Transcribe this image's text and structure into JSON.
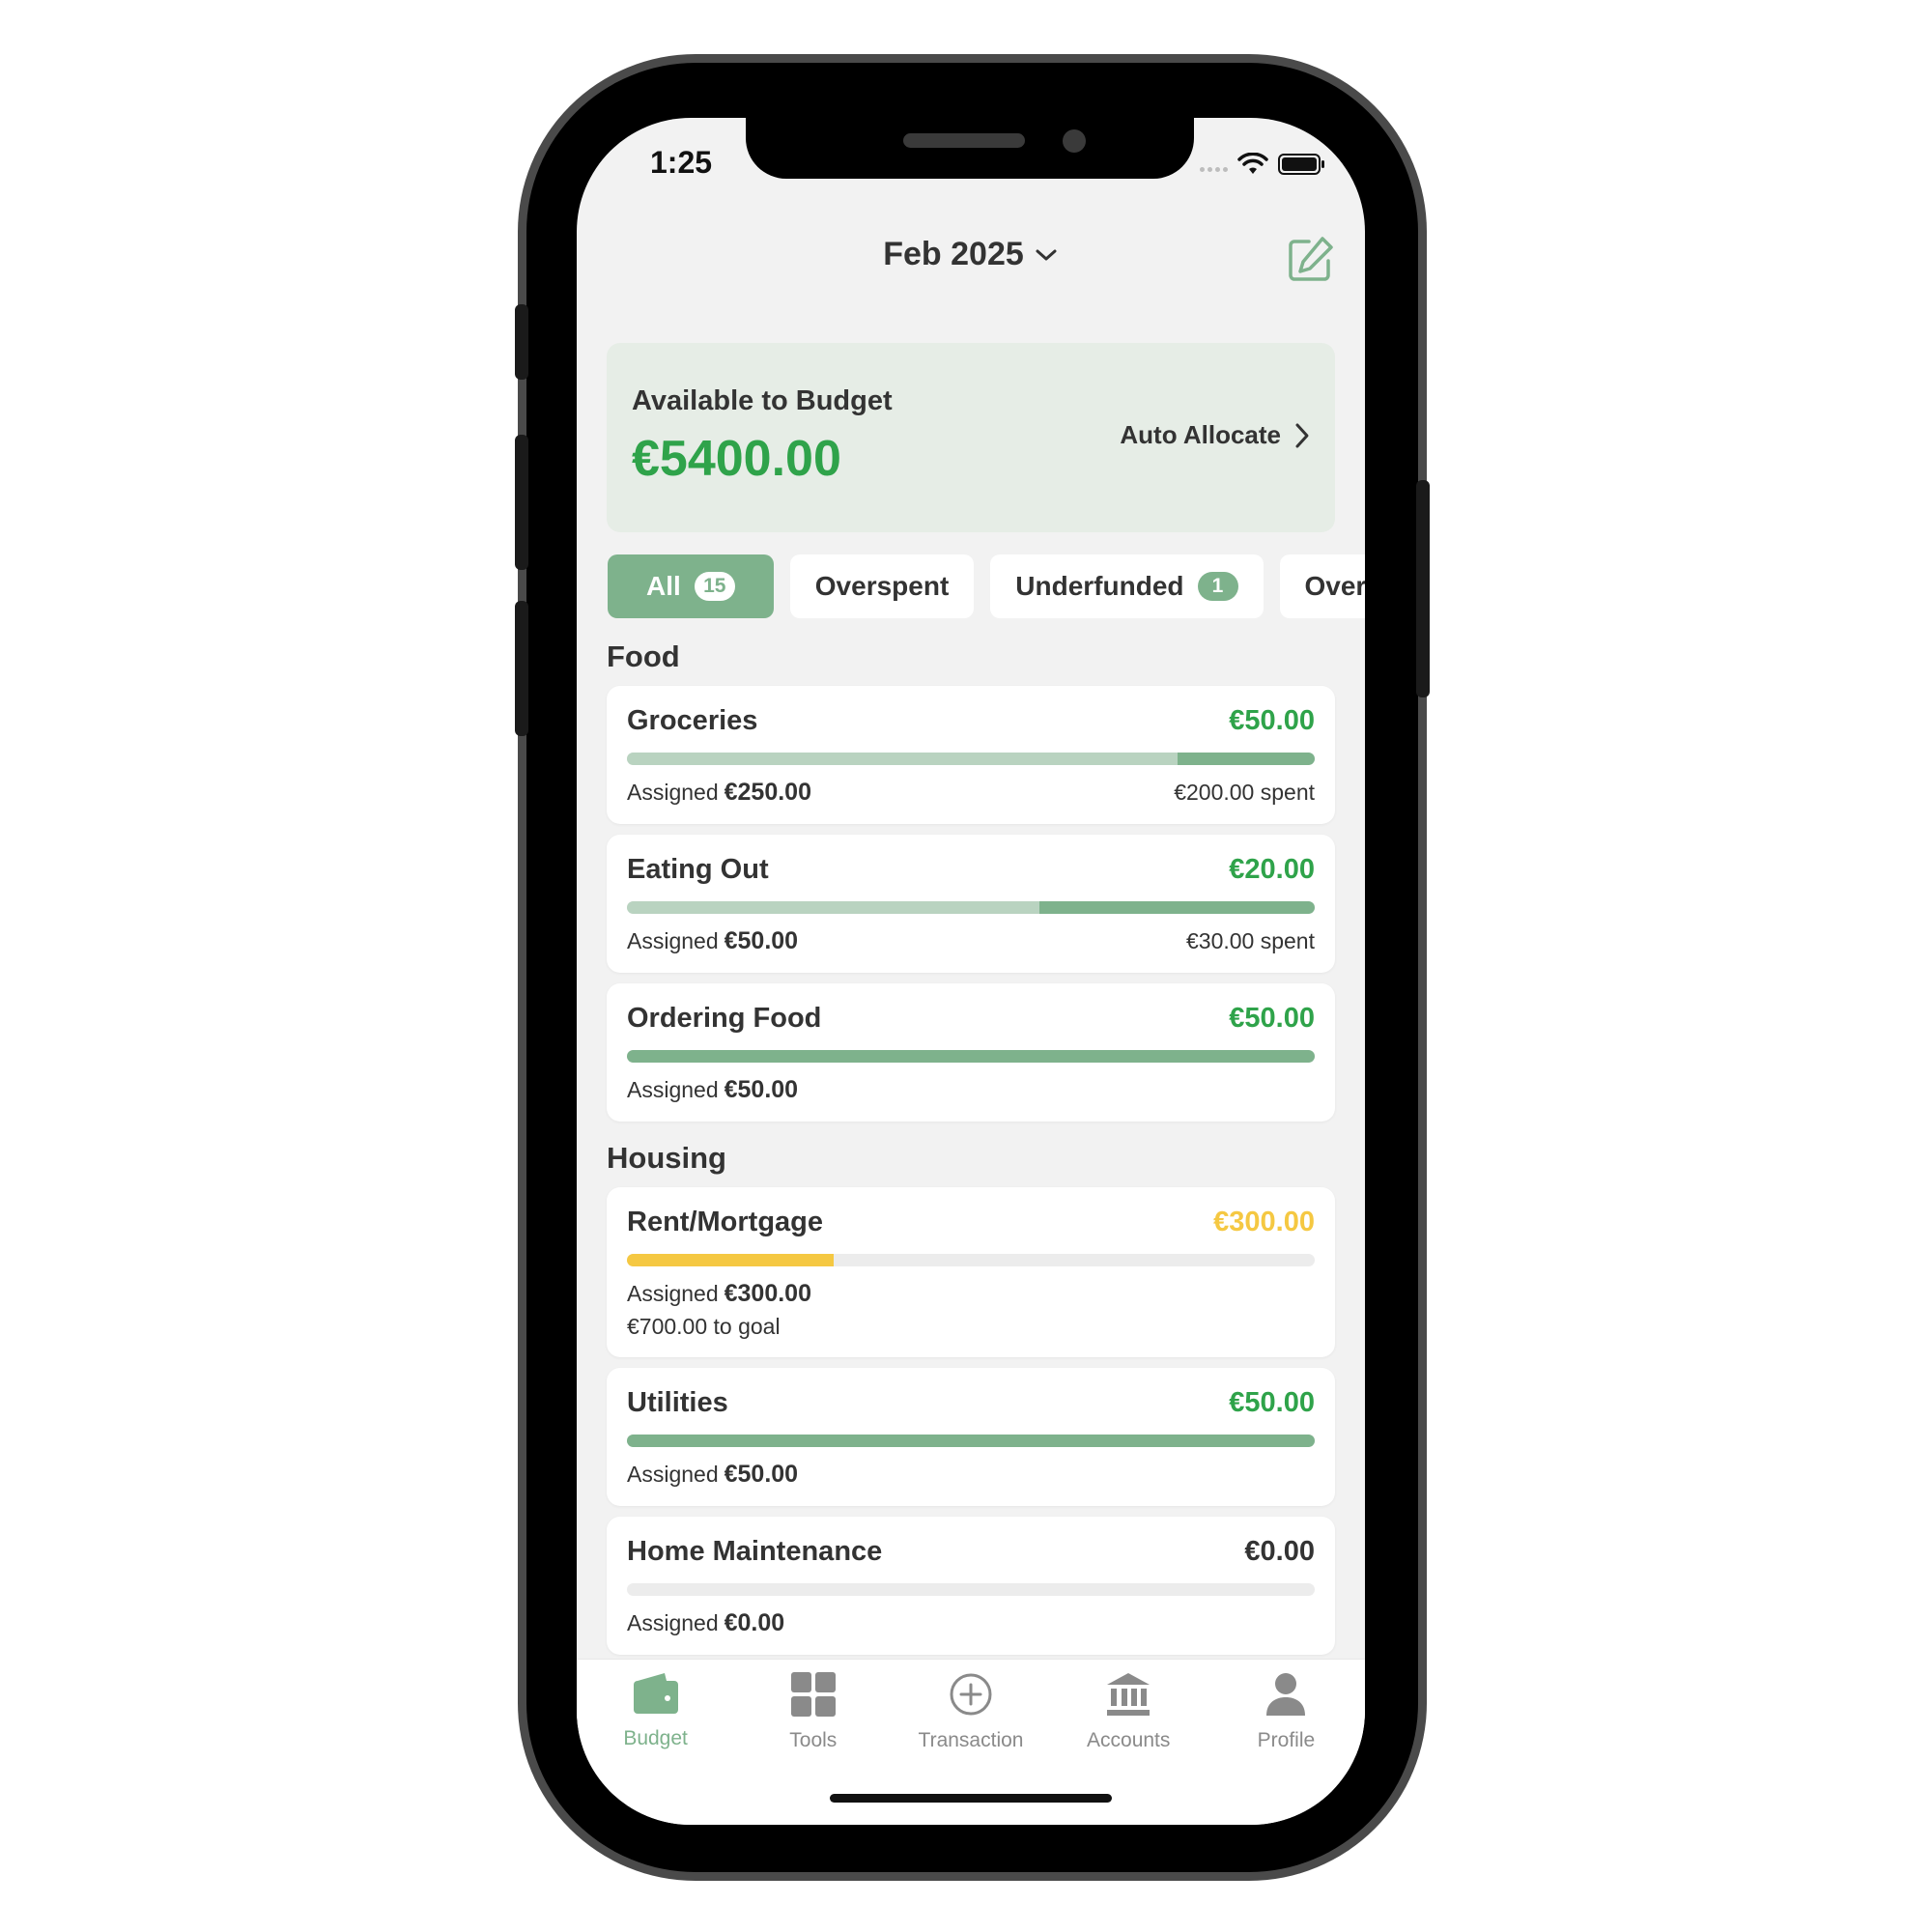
{
  "status_bar": {
    "time": "1:25"
  },
  "header": {
    "month": "Feb 2025",
    "edit_icon": "edit-icon"
  },
  "available": {
    "title": "Available to Budget",
    "amount": "€5400.00",
    "auto_allocate_label": "Auto Allocate"
  },
  "filters": [
    {
      "label": "All",
      "badge": "15",
      "active": true
    },
    {
      "label": "Overspent",
      "badge": "",
      "active": false
    },
    {
      "label": "Underfunded",
      "badge": "1",
      "active": false
    },
    {
      "label": "Over",
      "badge": "",
      "active": false
    }
  ],
  "assigned_label": "Assigned",
  "sections": [
    {
      "title": "Food",
      "categories": [
        {
          "name": "Groceries",
          "available": "€50.00",
          "assigned": "€250.00",
          "spent": "€200.00 spent",
          "spent_fraction": 0.8,
          "remaining_fraction": 0.2,
          "status": "funded"
        },
        {
          "name": "Eating Out",
          "available": "€20.00",
          "assigned": "€50.00",
          "spent": "€30.00 spent",
          "spent_fraction": 0.6,
          "remaining_fraction": 0.4,
          "status": "funded"
        },
        {
          "name": "Ordering Food",
          "available": "€50.00",
          "assigned": "€50.00",
          "spent": "",
          "spent_fraction": 0.0,
          "remaining_fraction": 1.0,
          "status": "funded"
        }
      ]
    },
    {
      "title": "Housing",
      "categories": [
        {
          "name": "Rent/Mortgage",
          "available": "€300.00",
          "assigned": "€300.00",
          "spent": "",
          "goal": "€700.00 to goal",
          "spent_fraction": 0.0,
          "remaining_fraction": 0.3,
          "status": "underfunded"
        },
        {
          "name": "Utilities",
          "available": "€50.00",
          "assigned": "€50.00",
          "spent": "",
          "spent_fraction": 0.0,
          "remaining_fraction": 1.0,
          "status": "funded"
        },
        {
          "name": "Home Maintenance",
          "available": "€0.00",
          "assigned": "€0.00",
          "spent": "",
          "spent_fraction": 0.0,
          "remaining_fraction": 0.0,
          "status": "empty"
        }
      ]
    }
  ],
  "tabs": [
    {
      "label": "Budget",
      "icon": "wallet-icon",
      "active": true
    },
    {
      "label": "Tools",
      "icon": "grid-icon",
      "active": false
    },
    {
      "label": "Transaction",
      "icon": "plus-circle-icon",
      "active": false
    },
    {
      "label": "Accounts",
      "icon": "bank-icon",
      "active": false
    },
    {
      "label": "Profile",
      "icon": "person-icon",
      "active": false
    }
  ],
  "colors": {
    "accent_green": "#7eb28c",
    "light_green": "#b9d3c0",
    "amount_green": "#2fa34a",
    "warning_yellow": "#f5c842",
    "text_dark": "#333333"
  }
}
